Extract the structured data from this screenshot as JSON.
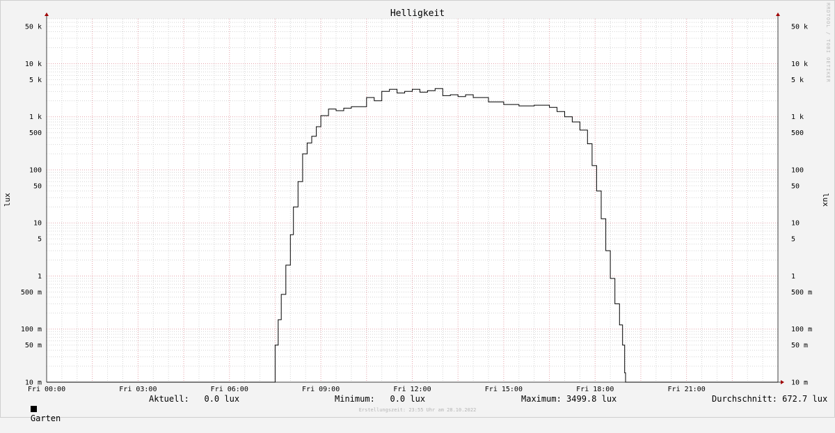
{
  "chart_data": {
    "type": "line",
    "title": "Helligkeit",
    "ylabel": "lux",
    "y_scale": "log",
    "ylim": [
      0.01,
      70000
    ],
    "xlim_hours": [
      0,
      24
    ],
    "x_ticks": [
      {
        "hour": 0,
        "label": "Fri 00:00"
      },
      {
        "hour": 3,
        "label": "Fri 03:00"
      },
      {
        "hour": 6,
        "label": "Fri 06:00"
      },
      {
        "hour": 9,
        "label": "Fri 09:00"
      },
      {
        "hour": 12,
        "label": "Fri 12:00"
      },
      {
        "hour": 15,
        "label": "Fri 15:00"
      },
      {
        "hour": 18,
        "label": "Fri 18:00"
      },
      {
        "hour": 21,
        "label": "Fri 21:00"
      }
    ],
    "y_ticks": [
      {
        "value": 50000,
        "label": "50 k"
      },
      {
        "value": 10000,
        "label": "10 k"
      },
      {
        "value": 5000,
        "label": "5 k"
      },
      {
        "value": 1000,
        "label": "1 k"
      },
      {
        "value": 500,
        "label": "500"
      },
      {
        "value": 100,
        "label": "100"
      },
      {
        "value": 50,
        "label": "50"
      },
      {
        "value": 10,
        "label": "10"
      },
      {
        "value": 5,
        "label": "5"
      },
      {
        "value": 1,
        "label": "1"
      },
      {
        "value": 0.5,
        "label": "500 m"
      },
      {
        "value": 0.1,
        "label": "100 m"
      },
      {
        "value": 0.05,
        "label": "50 m"
      },
      {
        "value": 0.01,
        "label": "10 m"
      }
    ],
    "grid": true,
    "series": [
      {
        "name": "Garten",
        "color": "#000000",
        "x_hours": [
          0,
          7.5,
          7.6,
          7.7,
          7.85,
          8.0,
          8.1,
          8.25,
          8.4,
          8.55,
          8.7,
          8.85,
          9.0,
          9.25,
          9.5,
          9.75,
          10.0,
          10.5,
          10.75,
          11.0,
          11.25,
          11.5,
          11.75,
          12.0,
          12.25,
          12.5,
          12.75,
          13.0,
          13.25,
          13.5,
          13.75,
          14.0,
          14.5,
          15.0,
          15.5,
          16.0,
          16.5,
          16.75,
          17.0,
          17.25,
          17.5,
          17.75,
          17.9,
          18.05,
          18.2,
          18.35,
          18.5,
          18.65,
          18.8,
          18.9,
          18.97,
          19.0,
          24
        ],
        "values": [
          0.01,
          0.05,
          0.15,
          0.45,
          1.6,
          6,
          20,
          60,
          200,
          320,
          430,
          650,
          1050,
          1400,
          1300,
          1450,
          1550,
          2300,
          2000,
          3000,
          3300,
          2800,
          3000,
          3300,
          2900,
          3100,
          3400,
          2500,
          2600,
          2400,
          2600,
          2300,
          1900,
          1700,
          1600,
          1650,
          1500,
          1250,
          1000,
          800,
          560,
          310,
          120,
          40,
          12,
          3,
          0.9,
          0.3,
          0.12,
          0.05,
          0.015,
          0.01,
          0.01
        ]
      }
    ]
  },
  "legend": {
    "series_name": "Garten",
    "current": "Aktuell:   0.0 lux",
    "minimum": "Minimum:   0.0 lux",
    "maximum": "Maximum: 3499.8 lux",
    "average": "Durchschnitt: 672.7 lux"
  },
  "footer": "Erstellungszeit: 23:55 Uhr am 28.10.2022",
  "watermark": "RRDTOOL / TOBI OETIKER"
}
